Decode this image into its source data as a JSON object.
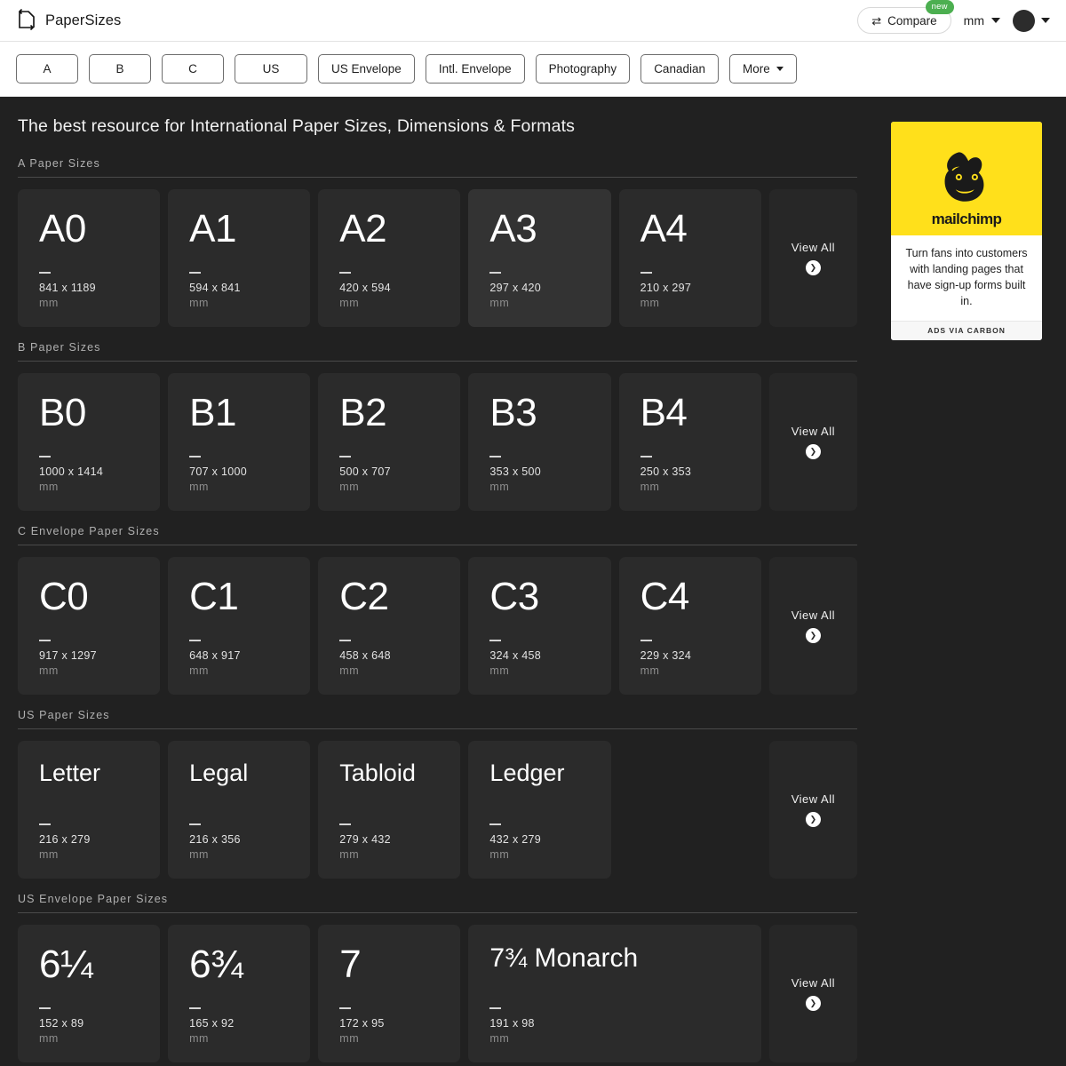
{
  "header": {
    "brand": "PaperSizes",
    "brand_icon": "page-corner-icon",
    "compare_label": "Compare",
    "compare_icon": "⇄",
    "new_badge": "new",
    "unit": "mm",
    "accent_badge_color": "#4caf50"
  },
  "nav": {
    "tabs": [
      {
        "label": "A"
      },
      {
        "label": "B"
      },
      {
        "label": "C"
      },
      {
        "label": "US"
      },
      {
        "label": "US Envelope"
      },
      {
        "label": "Intl. Envelope"
      },
      {
        "label": "Photography"
      },
      {
        "label": "Canadian"
      },
      {
        "label": "More"
      }
    ]
  },
  "main": {
    "headline": "The best resource for International Paper Sizes, Dimensions & Formats",
    "view_all_label": "View All",
    "view_all_icon": "chevron-right-icon",
    "sections": [
      {
        "title": "A Paper Sizes",
        "cards": [
          {
            "name": "A0",
            "dims": "841 x 1189",
            "unit": "mm"
          },
          {
            "name": "A1",
            "dims": "594 x 841",
            "unit": "mm"
          },
          {
            "name": "A2",
            "dims": "420 x 594",
            "unit": "mm"
          },
          {
            "name": "A3",
            "dims": "297 x 420",
            "unit": "mm",
            "hovered": true
          },
          {
            "name": "A4",
            "dims": "210 x 297",
            "unit": "mm"
          }
        ]
      },
      {
        "title": "B Paper Sizes",
        "cards": [
          {
            "name": "B0",
            "dims": "1000 x 1414",
            "unit": "mm"
          },
          {
            "name": "B1",
            "dims": "707 x 1000",
            "unit": "mm"
          },
          {
            "name": "B2",
            "dims": "500 x 707",
            "unit": "mm"
          },
          {
            "name": "B3",
            "dims": "353 x 500",
            "unit": "mm"
          },
          {
            "name": "B4",
            "dims": "250 x 353",
            "unit": "mm"
          }
        ]
      },
      {
        "title": "C Envelope Paper Sizes",
        "cards": [
          {
            "name": "C0",
            "dims": "917 x 1297",
            "unit": "mm"
          },
          {
            "name": "C1",
            "dims": "648 x 917",
            "unit": "mm"
          },
          {
            "name": "C2",
            "dims": "458 x 648",
            "unit": "mm"
          },
          {
            "name": "C3",
            "dims": "324 x 458",
            "unit": "mm"
          },
          {
            "name": "C4",
            "dims": "229 x 324",
            "unit": "mm"
          }
        ]
      },
      {
        "title": "US Paper Sizes",
        "cards": [
          {
            "name": "Letter",
            "dims": "216 x 279",
            "unit": "mm",
            "size": "small"
          },
          {
            "name": "Legal",
            "dims": "216 x 356",
            "unit": "mm",
            "size": "small"
          },
          {
            "name": "Tabloid",
            "dims": "279 x 432",
            "unit": "mm",
            "size": "small"
          },
          {
            "name": "Ledger",
            "dims": "432 x 279",
            "unit": "mm",
            "size": "small"
          }
        ]
      },
      {
        "title": "US Envelope Paper Sizes",
        "cards": [
          {
            "name": "6¼",
            "dims": "152 x 89",
            "unit": "mm"
          },
          {
            "name": "6¾",
            "dims": "165 x 92",
            "unit": "mm"
          },
          {
            "name": "7",
            "dims": "172 x 95",
            "unit": "mm"
          },
          {
            "name": "7¾ Monarch",
            "dims": "191 x 98",
            "unit": "mm",
            "size": "medium",
            "span": 2
          }
        ]
      }
    ]
  },
  "ad": {
    "brand": "mailchimp",
    "logo_icon": "mailchimp-monkey-icon",
    "body": "Turn fans into customers with landing pages that have sign-up forms built in.",
    "footer": "ADS VIA CARBON",
    "brand_color": "#ffe01b"
  }
}
